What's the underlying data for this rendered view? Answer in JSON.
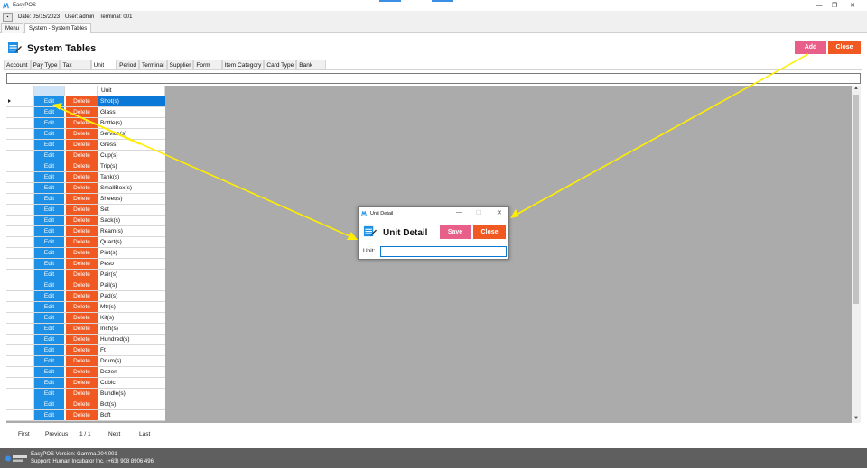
{
  "window": {
    "title": "EasyPOS",
    "minimize": "—",
    "maximize": "❐",
    "close": "✕"
  },
  "infobar": {
    "menu_button": "▪",
    "date": "Date: 05/15/2023",
    "user": "User: admin",
    "terminal": "Terminal: 001"
  },
  "menu_tabs": [
    "Menu",
    "System - System Tables"
  ],
  "page": {
    "title": "System Tables",
    "add_label": "Add",
    "close_label": "Close"
  },
  "sub_tabs": [
    "Account",
    "Pay Type",
    "Tax",
    "Unit",
    "Period",
    "Terminal",
    "Supplier",
    "Form",
    "Item Category",
    "Card Type",
    "Bank"
  ],
  "grid": {
    "header_unit": "Unit",
    "edit_label": "Edit",
    "delete_label": "Delete",
    "rows": [
      "Shot(s)",
      "Glass",
      "Bottle(s)",
      "Service(s)",
      "Gress",
      "Cup(s)",
      "Trip(s)",
      "Tank(s)",
      "SmallBox(s)",
      "Sheet(s)",
      "Set",
      "Sack(s)",
      "Ream(s)",
      "Quart(s)",
      "Pint(s)",
      "Peso",
      "Pair(s)",
      "Pail(s)",
      "Pad(s)",
      "Mtr(s)",
      "Kit(s)",
      "Inch(s)",
      "Hundred(s)",
      "Ft",
      "Drum(s)",
      "Dozen",
      "Cubic",
      "Bundle(s)",
      "Bot(s)",
      "Bdft"
    ]
  },
  "pager": {
    "first": "First",
    "previous": "Previous",
    "page": "1 / 1",
    "next": "Next",
    "last": "Last"
  },
  "status": {
    "version": "EasyPOS Version: Gamma.004.001",
    "support": "Support: Human Incubator Inc. (+63) 908 8906 496"
  },
  "dialog": {
    "window_title": "Unit Detail",
    "minimize": "—",
    "maximize": "☐",
    "close": "✕",
    "header": "Unit Detail",
    "save_label": "Save",
    "close_label": "Close",
    "unit_label": "Unit:",
    "unit_value": ""
  },
  "colors": {
    "accent_blue": "#1e90e6",
    "delete_orange": "#f05a22",
    "add_pink": "#e85f8a",
    "annotation_yellow": "#ffee00"
  }
}
